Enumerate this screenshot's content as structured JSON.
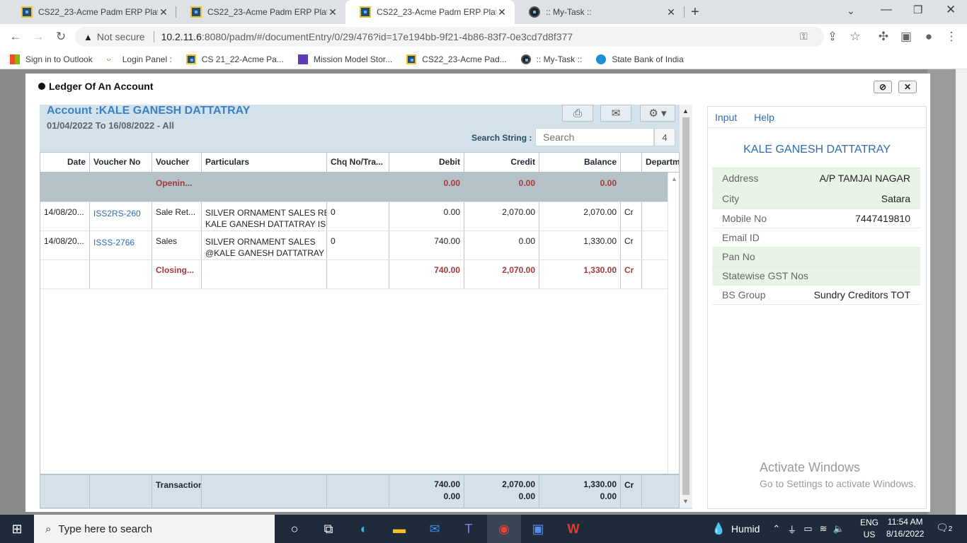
{
  "browser": {
    "tabs": [
      {
        "label": "CS22_23-Acme Padm ERP Platfor",
        "active": false
      },
      {
        "label": "CS22_23-Acme Padm ERP Platfor",
        "active": false
      },
      {
        "label": "CS22_23-Acme Padm ERP Platfor",
        "active": true
      },
      {
        "label": ":: My-Task ::",
        "active": false
      }
    ],
    "new_tab": "+",
    "not_secure": "Not secure",
    "url_host": "10.2.11.6",
    "url_rest": ":8080/padm/#/documentEntry/0/29/476?id=17e194bb-9f21-4b86-83f7-0e3cd7d8f377",
    "bookmarks": [
      "Sign in to Outlook",
      "Login Panel :",
      "CS 21_22-Acme Pa...",
      "Mission Model Stor...",
      "CS22_23-Acme Pad...",
      ":: My-Task ::",
      "State Bank of India"
    ]
  },
  "modal": {
    "title": "Ledger Of An Account",
    "close": "✕"
  },
  "ledger": {
    "account_title": "Account :KALE GANESH DATTATRAY",
    "date_range": "01/04/2022 To 16/08/2022 - All",
    "search_label": "Search String :",
    "search_placeholder": "Search",
    "search_count": "4",
    "columns": [
      "Date",
      "Voucher No",
      "Voucher",
      "Particulars",
      "Chq No/Tra...",
      "Debit",
      "Credit",
      "Balance",
      "",
      "Departm"
    ],
    "opening": {
      "voucher": "Openin...",
      "debit": "0.00",
      "credit": "0.00",
      "balance": "0.00"
    },
    "rows": [
      {
        "date": "14/08/20...",
        "voucher_no": "ISS2RS-260",
        "voucher": "Sale Ret...",
        "particulars1": "SILVER ORNAMENT SALES RE",
        "particulars2": "KALE GANESH DATTATRAY IS",
        "chq": "0",
        "debit": "0.00",
        "credit": "2,070.00",
        "balance": "2,070.00",
        "drcr": "Cr"
      },
      {
        "date": "14/08/20...",
        "voucher_no": "ISSS-2766",
        "voucher": "Sales",
        "particulars1": "SILVER ORNAMENT SALES",
        "particulars2": "@KALE GANESH DATTATRAY",
        "chq": "0",
        "debit": "740.00",
        "credit": "0.00",
        "balance": "1,330.00",
        "drcr": "Cr"
      }
    ],
    "closing": {
      "voucher": "Closing...",
      "debit": "740.00",
      "credit": "2,070.00",
      "balance": "1,330.00",
      "drcr": "Cr"
    },
    "footer": {
      "label": "Transaction",
      "debit1": "740.00",
      "debit2": "0.00",
      "credit1": "2,070.00",
      "credit2": "0.00",
      "balance1": "1,330.00",
      "balance2": "0.00",
      "drcr": "Cr"
    }
  },
  "info": {
    "tabs": [
      "Input",
      "Help"
    ],
    "name": "KALE GANESH DATTATRAY",
    "fields": [
      {
        "key": "Address",
        "value": "A/P TAMJAI NAGAR"
      },
      {
        "key": "City",
        "value": "Satara"
      },
      {
        "key": "Mobile No",
        "value": "7447419810"
      },
      {
        "key": "Email ID",
        "value": ""
      },
      {
        "key": "Pan No",
        "value": ""
      },
      {
        "key": "Statewise GST Nos",
        "value": ""
      },
      {
        "key": "BS Group",
        "value": "Sundry Creditors TOT"
      }
    ]
  },
  "watermark": {
    "line1": "Activate Windows",
    "line2": "Go to Settings to activate Windows."
  },
  "taskbar": {
    "search_placeholder": "Type here to search",
    "weather": "Humid",
    "lang1": "ENG",
    "lang2": "US",
    "time": "11:54 AM",
    "date": "8/16/2022",
    "notifications": "2"
  }
}
